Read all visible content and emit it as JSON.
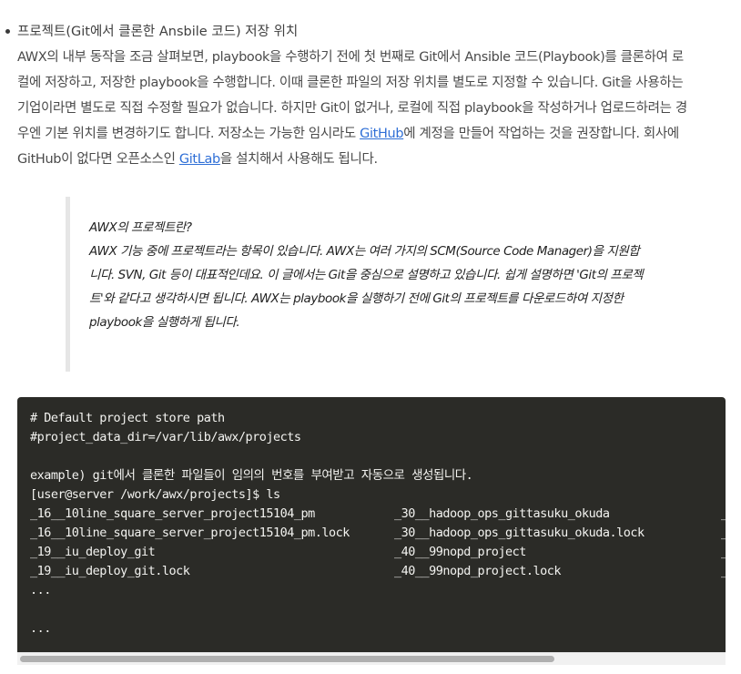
{
  "section": {
    "title": "프로젝트(Git에서 클론한 Ansbile 코드) 저장 위치",
    "paragraph": {
      "line1": "AWX의 내부 동작을 조금 살펴보면, playbook을 수행하기 전에 첫 번째로 Git에서 Ansible 코드(Playbook)를 클론하여 로",
      "line2": "컬에 저장하고, 저장한 playbook을 수행합니다. 이때 클론한 파일의 저장 위치를 별도로 지정할 수 있습니다. Git을 사용하는",
      "line3": "기업이라면 별도로 직접 수정할 필요가 없습니다. 하지만 Git이 없거나, 로컬에 직접 playbook을 작성하거나 업로드하려는 경",
      "line4_pre": "우엔 기본 위치를 변경하기도 합니다. 저장소는 가능한 임시라도 ",
      "line4_link": "GitHub",
      "line4_post": "에 계정을 만들어 작업하는 것을 권장합니다. 회사에",
      "line5_pre": "GitHub이 없다면 오픈소스인 ",
      "line5_link": "GitLab",
      "line5_post": "을 설치해서 사용해도 됩니다."
    }
  },
  "quote": {
    "lines": [
      "AWX의 프로젝트란?",
      "AWX 기능 중에 프로젝트라는 항목이 있습니다. AWX는 여러 가지의 SCM(Source Code Manager)을 지원합",
      "니다. SVN, Git 등이 대표적인데요. 이 글에서는 Git을 중심으로 설명하고 있습니다. 쉽게 설명하면 'Git의 프로젝",
      "트'와 같다고 생각하시면 됩니다. AWX는 playbook을 실행하기 전에 Git의 프로젝트를 다운로드하여 지정한",
      "playbook을 실행하게 됩니다."
    ]
  },
  "code": {
    "line1": "# Default project store path",
    "line2": "#project_data_dir=/var/lib/awx/projects",
    "line3": "",
    "line4": "example) git에서 클론한 파일들이 임의의 번호를 부여받고 자동으로 생성됩니다.",
    "line5": "[user@server /work/awx/projects]$ ls",
    "rows": [
      {
        "c1": "_16__10line_square_server_project15104_pm",
        "c2": "_30__hadoop_ops_gittasuku_okuda",
        "c3": "_"
      },
      {
        "c1": "_16__10line_square_server_project15104_pm.lock",
        "c2": "_30__hadoop_ops_gittasuku_okuda.lock",
        "c3": "_"
      },
      {
        "c1": "_19__iu_deploy_git",
        "c2": "_40__99nopd_project",
        "c3": "_"
      },
      {
        "c1": "_19__iu_deploy_git.lock",
        "c2": "_40__99nopd_project.lock",
        "c3": "_"
      }
    ],
    "line10": "...",
    "line11": "",
    "line12": "..."
  }
}
